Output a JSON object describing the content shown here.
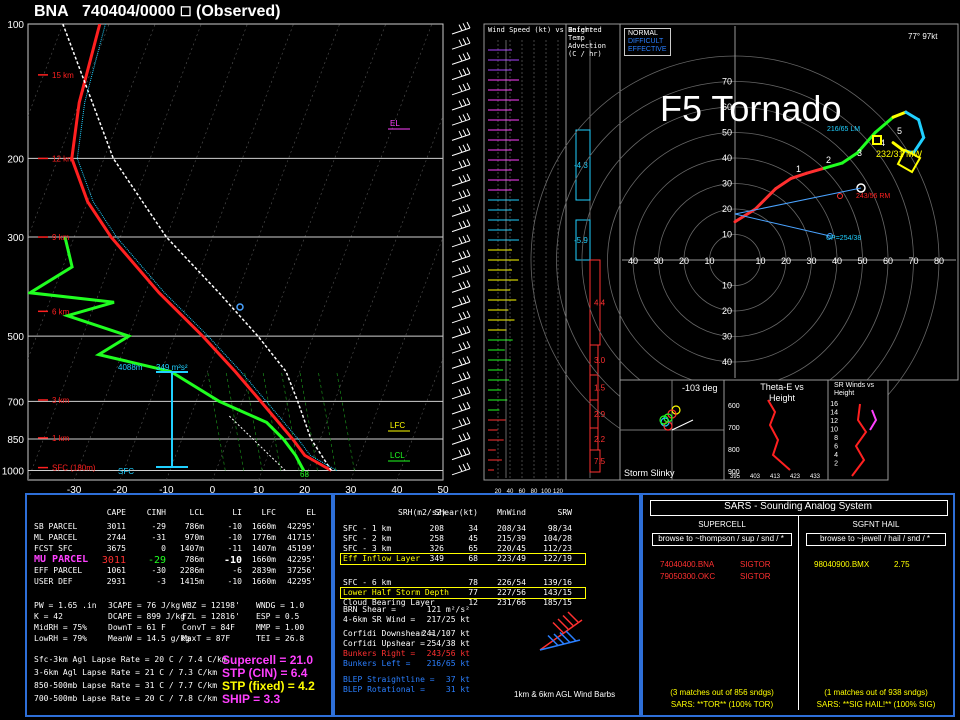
{
  "header": {
    "station": "BNA",
    "datetime": "740404/0000",
    "status": "(Observed)"
  },
  "overlay_title": "F5 Tornado",
  "colors": {
    "temp": "#ff2020",
    "dewpoint": "#20ff20",
    "virtual": "#ff7f7f",
    "parcel": "#ffffff",
    "grid": "#d0d0d0",
    "panel_border": "#2e6fd8",
    "cyan": "#20d0ff",
    "yellow": "#ffff00",
    "magenta": "#ff40ff"
  },
  "chart_data": [
    {
      "type": "line",
      "name": "skewt",
      "pressure_levels": [
        100,
        200,
        300,
        500,
        700,
        850,
        1000
      ],
      "x_ticks": [
        -30,
        -20,
        -10,
        0,
        10,
        20,
        30,
        40,
        50
      ],
      "height_labels": [
        "15 km",
        "12 km",
        "9 km",
        "6 km",
        "3 km",
        "1 km",
        "SFC (180m)"
      ],
      "height_pressures": [
        130,
        200,
        300,
        440,
        695,
        845,
        985
      ],
      "series": [
        {
          "key": "temp",
          "points": [
            [
              1000,
              25
            ],
            [
              925,
              18
            ],
            [
              850,
              14
            ],
            [
              700,
              4
            ],
            [
              600,
              -4
            ],
            [
              500,
              -14
            ],
            [
              400,
              -27
            ],
            [
              300,
              -42
            ],
            [
              250,
              -50
            ],
            [
              200,
              -57
            ],
            [
              150,
              -60
            ],
            [
              100,
              -62
            ]
          ]
        },
        {
          "key": "dewpoint",
          "points": [
            [
              1000,
              19
            ],
            [
              925,
              16
            ],
            [
              850,
              12
            ],
            [
              780,
              7
            ],
            [
              700,
              -5
            ],
            [
              600,
              -18
            ],
            [
              550,
              -35
            ],
            [
              500,
              -30
            ],
            [
              450,
              -45
            ],
            [
              420,
              -36
            ],
            [
              400,
              -55
            ],
            [
              350,
              -48
            ],
            [
              300,
              -52
            ]
          ]
        },
        {
          "key": "parcel",
          "points": [
            [
              1000,
              25
            ],
            [
              850,
              18
            ],
            [
              700,
              12
            ],
            [
              600,
              7
            ],
            [
              500,
              -2
            ],
            [
              400,
              -14
            ],
            [
              300,
              -30
            ],
            [
              200,
              -48
            ],
            [
              100,
              -70
            ]
          ]
        }
      ],
      "annotations": {
        "el": "EL",
        "lfc": "LFC",
        "lcl": "LCL",
        "helicity_height": "4088m",
        "helicity": "349 m²s²",
        "sfc": "SFC",
        "sfc_temp": "68"
      }
    },
    {
      "type": "bar",
      "name": "wind_speed",
      "title": "Wind Speed (kt) vs Height",
      "x_ticks": [
        20,
        40,
        60,
        80,
        100,
        120
      ]
    },
    {
      "type": "bar",
      "name": "temp_advection",
      "title": "Inferred Temp Advection (C / hr)",
      "labels": [
        "-4.3",
        "-5.9",
        "4.4",
        "3.0",
        "1.5",
        "2.9",
        "2.2",
        "7.5"
      ]
    },
    {
      "type": "line",
      "name": "hodograph",
      "legend": [
        "NORMAL",
        "DIFFICULT",
        "EFFECTIVE"
      ],
      "corner_label": "77° 97kt",
      "x_ticks": [
        40,
        30,
        20,
        10,
        10,
        20,
        30,
        40,
        50,
        60,
        70,
        80
      ],
      "y_ticks_up": [
        10,
        20,
        30,
        40,
        50,
        60,
        70
      ],
      "y_ticks_down": [
        10,
        20,
        30,
        40,
        50,
        60,
        70
      ],
      "points": [
        [
          0,
          15
        ],
        [
          8,
          20
        ],
        [
          16,
          28
        ],
        [
          22,
          32
        ],
        [
          28,
          34
        ],
        [
          35,
          36
        ],
        [
          42,
          38
        ],
        [
          48,
          42
        ],
        [
          55,
          50
        ],
        [
          62,
          56
        ],
        [
          67,
          58
        ],
        [
          72,
          55
        ],
        [
          74,
          48
        ],
        [
          70,
          42
        ],
        [
          66,
          43
        ],
        [
          62,
          46
        ]
      ],
      "numbers": [
        "1",
        "2",
        "3",
        "4",
        "5"
      ],
      "labels": {
        "lm": "216/65 LM",
        "mw": "232/31 MW",
        "rm": "243/56 RM",
        "upshear": "UP=254/38"
      }
    },
    {
      "type": "scatter",
      "name": "storm_slinky",
      "title": "Storm Slinky",
      "angle": "-103 deg"
    },
    {
      "type": "line",
      "name": "theta_e",
      "title": "Theta-E vs Height",
      "y_ticks": [
        600,
        700,
        800,
        900
      ],
      "x_ticks": [
        395,
        403,
        413,
        423,
        433
      ]
    },
    {
      "type": "line",
      "name": "srwinds",
      "title": "SR Winds vs Height",
      "y_ticks": [
        16,
        14,
        12,
        10,
        8,
        6,
        4,
        2
      ]
    }
  ],
  "parcels": {
    "headers": [
      "CAPE",
      "CINH",
      "LCL",
      "LI",
      "LFC",
      "EL"
    ],
    "rows": [
      {
        "name": "SB PARCEL",
        "vals": [
          "3011",
          "-29",
          "786m",
          "-10",
          "1660m",
          "42295'"
        ]
      },
      {
        "name": "ML PARCEL",
        "vals": [
          "2744",
          "-31",
          "970m",
          "-10",
          "1776m",
          "41715'"
        ]
      },
      {
        "name": "FCST SFC",
        "vals": [
          "3675",
          "0",
          "1407m",
          "-11",
          "1407m",
          "45199'"
        ]
      },
      {
        "name": "MU PARCEL",
        "vals": [
          "3011",
          "-29",
          "786m",
          "-10",
          "1660m",
          "42295'"
        ]
      },
      {
        "name": "EFF PARCEL",
        "vals": [
          "1061",
          "-30",
          "2286m",
          "-6",
          "2839m",
          "37256'"
        ]
      },
      {
        "name": "USER DEF",
        "vals": [
          "2931",
          "-3",
          "1415m",
          "-10",
          "1660m",
          "42295'"
        ]
      }
    ],
    "indices": [
      [
        "PW = 1.65 .in",
        "3CAPE = 76 J/kg",
        "WBZ = 12198'",
        "WNDG = 1.0"
      ],
      [
        "K = 42",
        "DCAPE = 899 J/kg",
        "FZL = 12816'",
        "ESP = 0.5"
      ],
      [
        "MidRH = 75%",
        "DownT = 61 F",
        "ConvT = 84F",
        "MMP = 1.00"
      ],
      [
        "LowRH = 79%",
        "MeanW = 14.5 g/kg",
        "MaxT = 87F",
        "TEI = 26.8"
      ]
    ],
    "lapse": [
      "Sfc-3km Agl Lapse Rate = 20 C / 7.4 C/km",
      "3-6km Agl Lapse Rate = 21 C / 7.3 C/km",
      "850-500mb Lapse Rate = 31 C / 7.7 C/km",
      "700-500mb Lapse Rate = 20 C / 7.8 C/km"
    ],
    "composite": [
      "Supercell = 21.0",
      "STP (CIN) = 6.4",
      "STP (fixed) = 4.2",
      "SHIP = 3.3"
    ]
  },
  "kinematics": {
    "headers": [
      "SRH(m2/s2)",
      "Shear(kt)",
      "MnWind",
      "SRW"
    ],
    "rows": [
      {
        "name": "SFC - 1 km",
        "vals": [
          "208",
          "34",
          "208/34",
          "98/34"
        ]
      },
      {
        "name": "SFC - 2 km",
        "vals": [
          "258",
          "45",
          "215/39",
          "104/28"
        ]
      },
      {
        "name": "SFC - 3 km",
        "vals": [
          "326",
          "65",
          "220/45",
          "112/23"
        ]
      },
      {
        "name": "Eff Inflow Layer",
        "vals": [
          "349",
          "68",
          "223/49",
          "122/19"
        ]
      },
      {
        "name": "SFC - 6 km",
        "vals": [
          "",
          "78",
          "226/54",
          "139/16"
        ]
      },
      {
        "name": "Lower Half Storm Depth",
        "vals": [
          "",
          "77",
          "227/56",
          "143/15"
        ]
      },
      {
        "name": "Cloud Bearing Layer",
        "vals": [
          "",
          "12",
          "231/66",
          "185/15"
        ]
      }
    ],
    "misc": [
      {
        "label": "BRN Shear =",
        "val": "121 m²/s²"
      },
      {
        "label": "4-6km SR Wind =",
        "val": "217/25 kt"
      },
      {
        "label": "Corfidi Downshear =",
        "val": "241/107 kt"
      },
      {
        "label": "Corfidi Upshear =",
        "val": "254/38 kt"
      },
      {
        "label": "Bunkers Right =",
        "val": "243/56 kt"
      },
      {
        "label": "Bunkers Left =",
        "val": "216/65 kt"
      },
      {
        "label": "BLEP Straightline =",
        "val": "37 kt"
      },
      {
        "label": "BLEP Rotational =",
        "val": "31 kt"
      }
    ],
    "barbs_caption": "1km & 6km AGL Wind Barbs"
  },
  "sars": {
    "title": "SARS - Sounding Analog System",
    "supercell": {
      "header": "SUPERCELL",
      "browse": "browse to ~thompson / sup / snd / *",
      "matches": [
        [
          "74040400.BNA",
          "SIGTOR"
        ],
        [
          "79050300.OKC",
          "SIGTOR"
        ]
      ],
      "footer1": "(3 matches out of 856 sndgs)",
      "footer2": "SARS: **TOR** (100% TOR)"
    },
    "hail": {
      "header": "SGFNT HAIL",
      "browse": "browse to ~jewell / hail / snd / *",
      "matches": [
        [
          "98040900.BMX",
          "2.75"
        ]
      ],
      "footer1": "(1 matches out of 938 sndgs)",
      "footer2": "SARS: **SIG HAIL!** (100% SIG)"
    }
  }
}
